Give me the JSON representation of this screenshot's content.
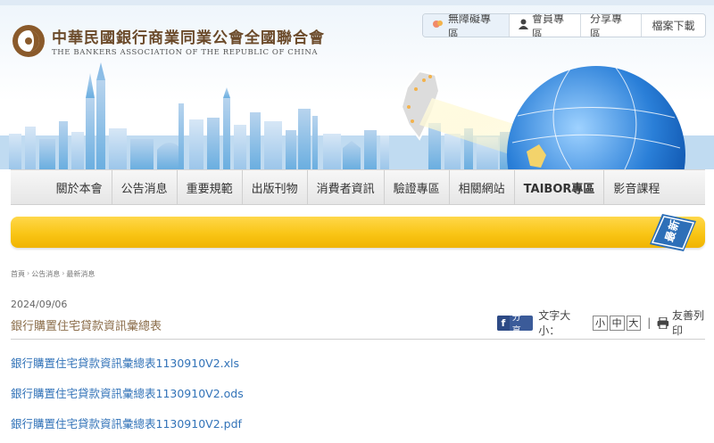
{
  "header": {
    "logo_zh": "中華民國銀行商業同業公會全國聯合會",
    "logo_en": "THE BANKERS ASSOCIATION OF THE REPUBLIC OF CHINA"
  },
  "topnav": {
    "accessibility": "無障礙專區",
    "member": "會員專區",
    "share": "分享專區",
    "download": "檔案下載"
  },
  "mainnav": {
    "items": [
      "關於本會",
      "公告消息",
      "重要規範",
      "出版刊物",
      "消費者資訊",
      "驗證專區",
      "相關網站",
      "TAIBOR專區",
      "影音課程"
    ]
  },
  "section_tag": "最新",
  "breadcrumb": [
    "首頁",
    "公告消息",
    "最新消息"
  ],
  "article": {
    "date": "2024/09/06",
    "title": "銀行購置住宅貸款資訊彙總表"
  },
  "tools": {
    "share_label": "分享",
    "font_size_label": "文字大小：",
    "sizes": [
      "小",
      "中",
      "大"
    ],
    "print_label": "友善列印"
  },
  "files": [
    "銀行購置住宅貸款資訊彙總表1130910V2.xls",
    "銀行購置住宅貸款資訊彙總表1130910V2.ods",
    "銀行購置住宅貸款資訊彙總表1130910V2.pdf"
  ],
  "colors": {
    "accent_brown": "#8b6d4a",
    "link_blue": "#3273b8",
    "bar_yellow": "#f9c516",
    "sky_blue": "#6aaee0",
    "facebook": "#3b5b99"
  }
}
